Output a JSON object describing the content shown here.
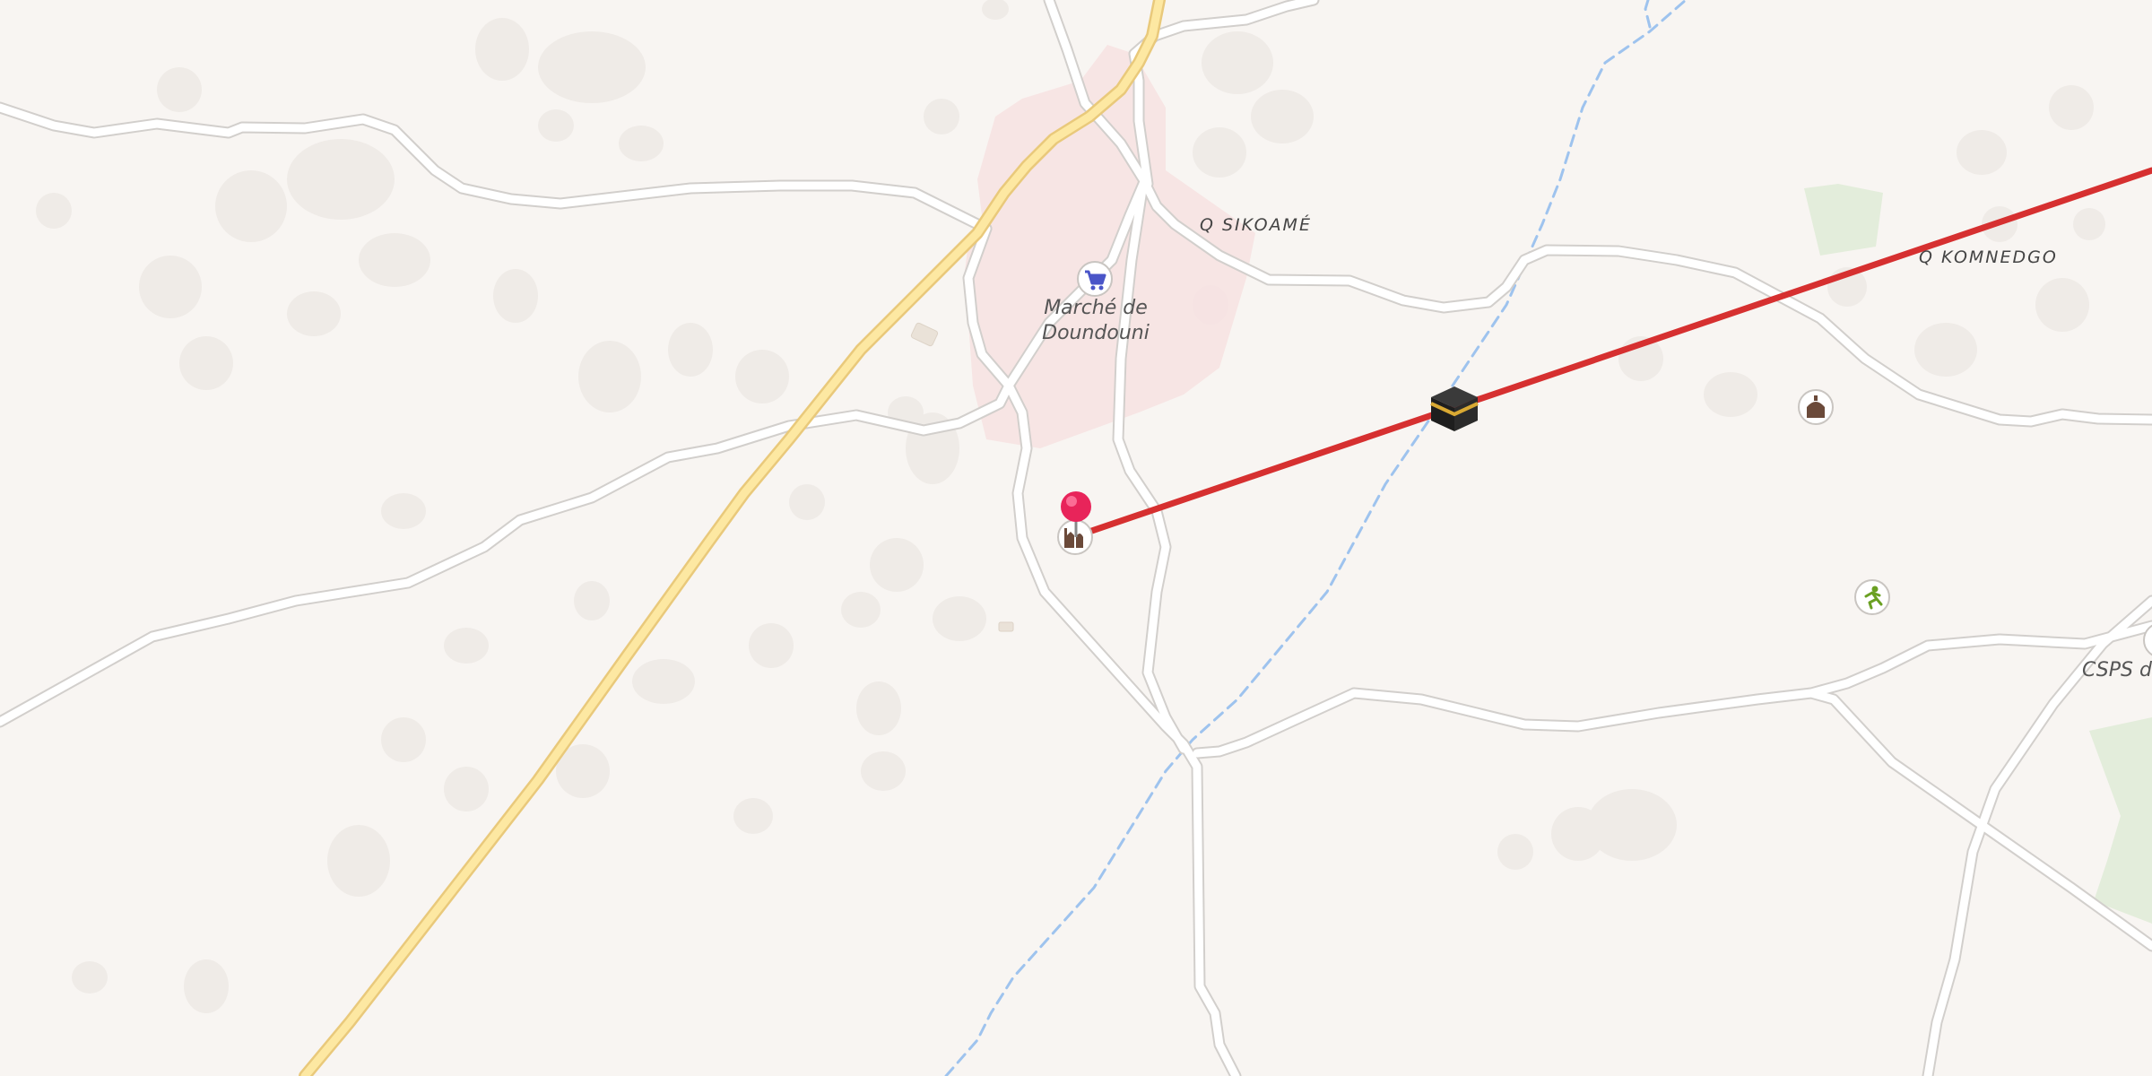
{
  "map": {
    "place_labels": {
      "sikoame": "Q SIKOAMÉ",
      "komnedgo": "Q KOMNEDGO"
    },
    "poi_labels": {
      "market_line1": "Marché de",
      "market_line2": "Doundouni",
      "csps": "CSPS de"
    },
    "icons": {
      "market": "shopping-cart-icon",
      "kaaba": "kaaba-icon",
      "mosque_1": "mosque-icon",
      "mosque_2": "mosque-icon",
      "sports": "running-person-icon",
      "pin": "location-pin-icon"
    },
    "colors": {
      "background": "#f8f5f2",
      "road": "#ffffff",
      "road_casing": "#d2cfcc",
      "highway": "#fde8a2",
      "highway_casing": "#e9c97b",
      "waterway": "#9ec3ee",
      "residential": "#f7e2e2",
      "park": "#e3eddb",
      "qibla_line": "#d63030",
      "pin": "#e8245a"
    }
  }
}
